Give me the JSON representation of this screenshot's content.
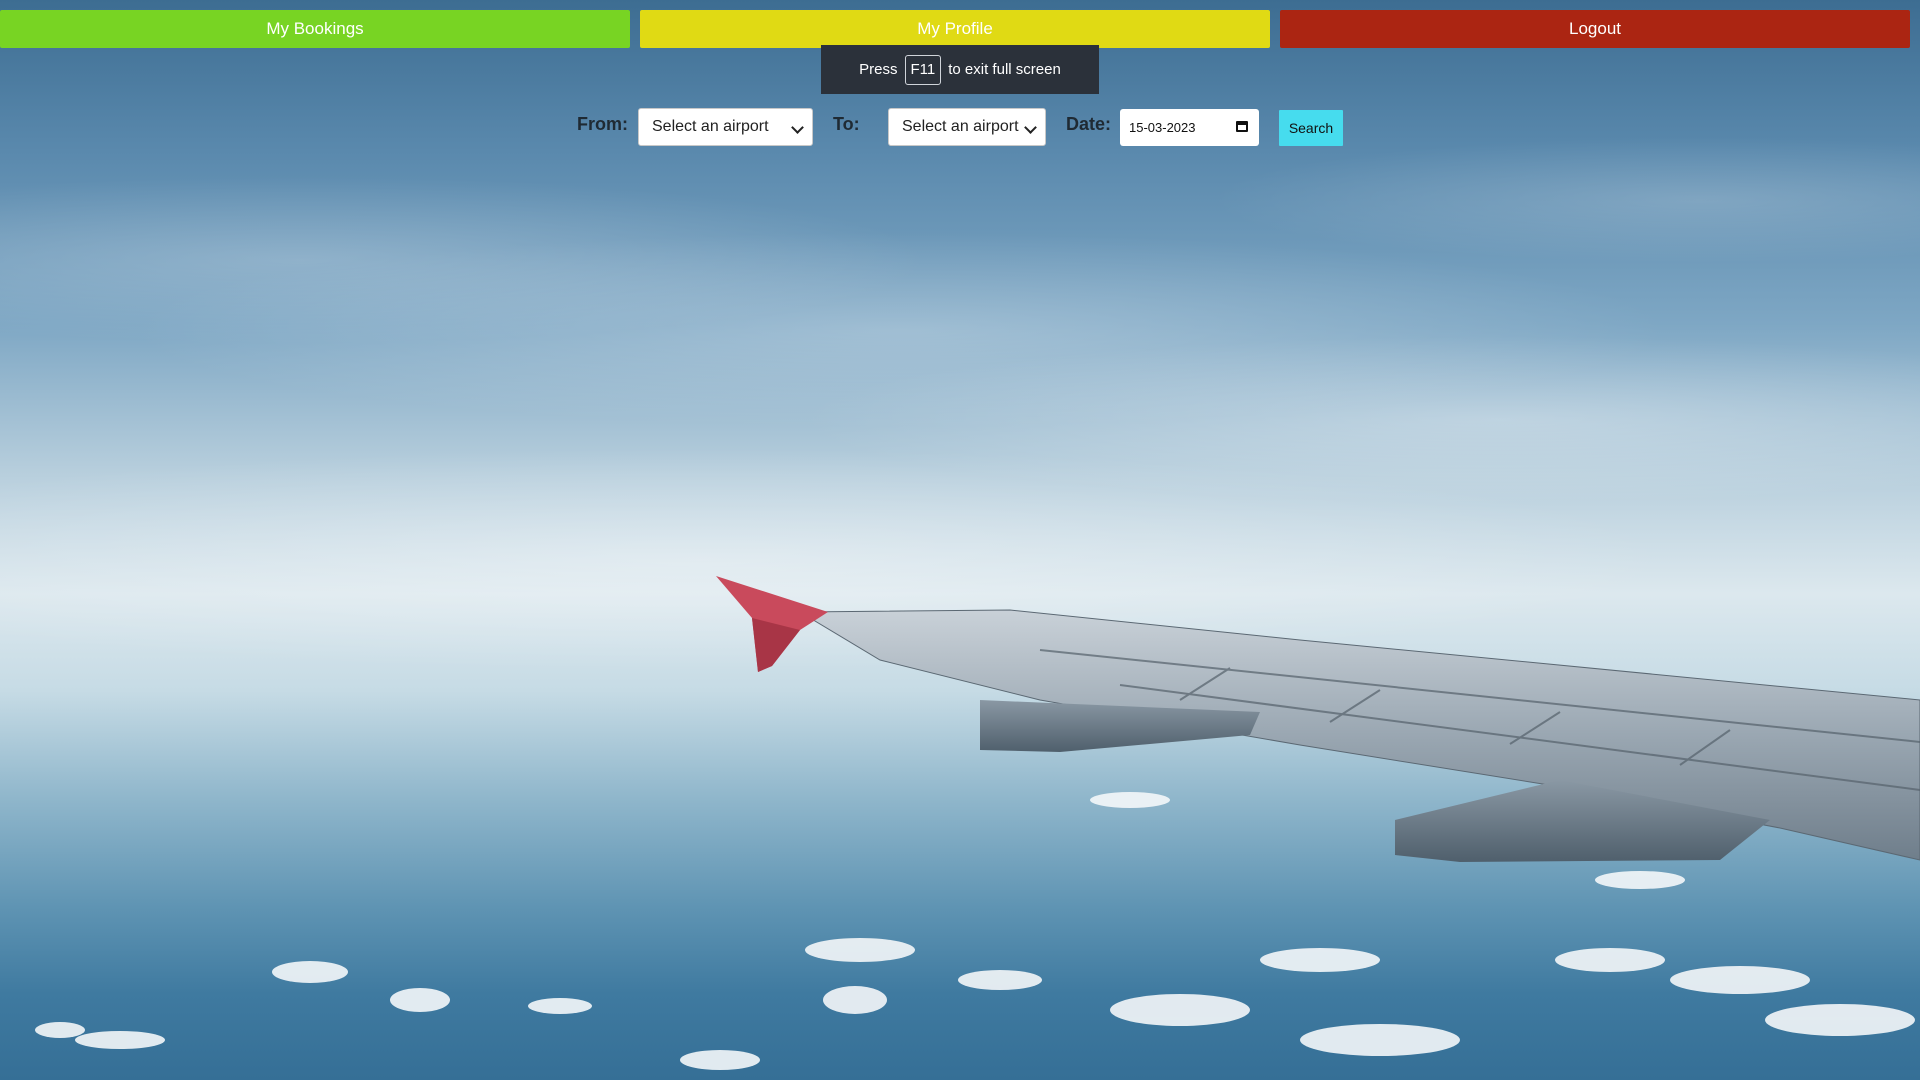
{
  "nav": {
    "bookings_label": "My Bookings",
    "profile_label": "My Profile",
    "logout_label": "Logout"
  },
  "toast": {
    "prefix": "Press",
    "key": "F11",
    "suffix": "to exit full screen"
  },
  "search_form": {
    "from_label": "From:",
    "from_value": "Select an airport",
    "to_label": "To:",
    "to_value": "Select an airport",
    "date_label": "Date:",
    "date_value": "15-03-2023",
    "search_label": "Search"
  },
  "colors": {
    "bookings": "#78d423",
    "profile": "#e0da14",
    "logout": "#ab2512",
    "search": "#46dcee"
  },
  "icons": {
    "select_chevron": "chevron-down-icon",
    "date_picker": "calendar-icon"
  }
}
